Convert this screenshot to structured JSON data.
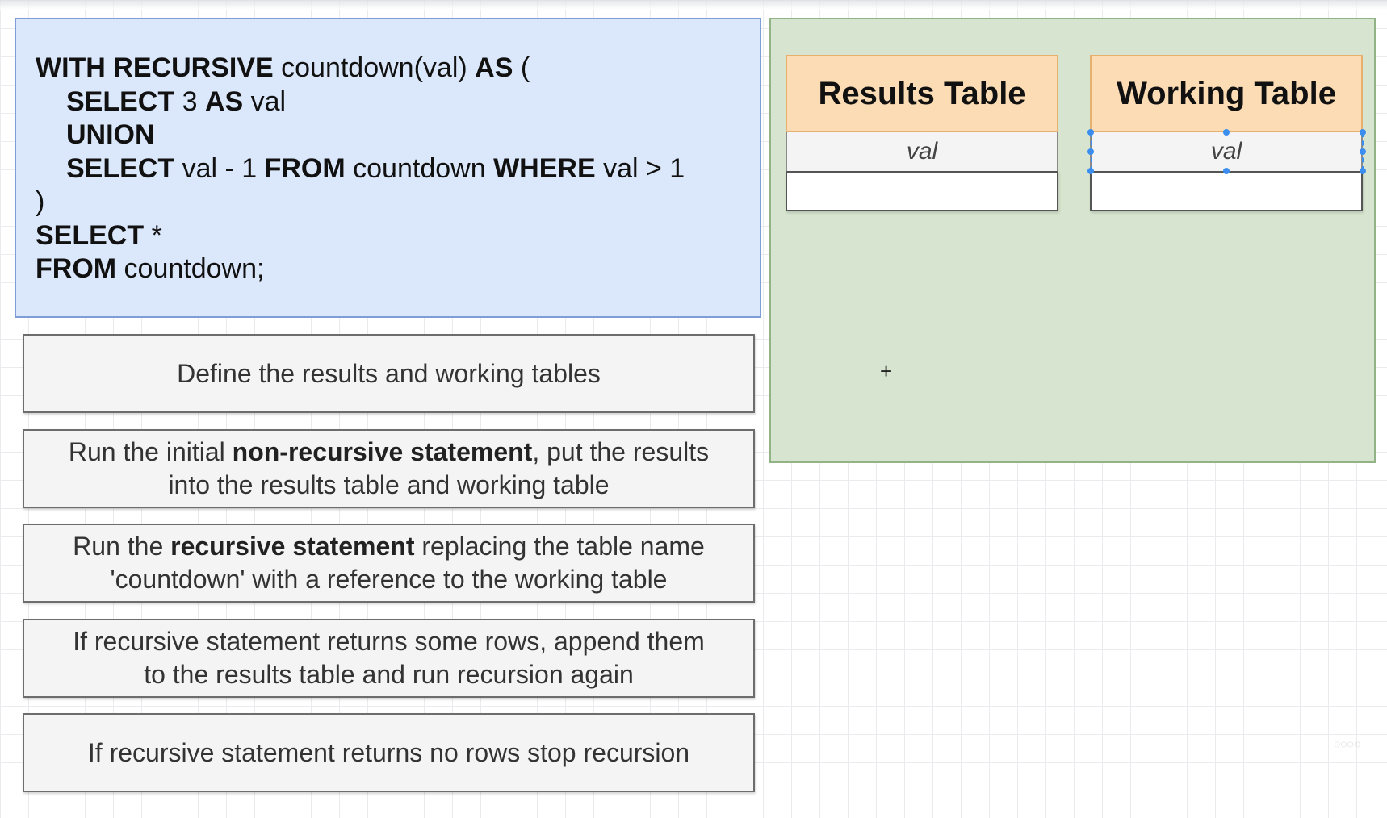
{
  "code": {
    "lines": [
      {
        "indent": false,
        "parts": [
          {
            "t": "WITH RECURSIVE",
            "b": true
          },
          {
            "t": " countdown(val) ",
            "b": false
          },
          {
            "t": "AS",
            "b": true
          },
          {
            "t": " (",
            "b": false
          }
        ]
      },
      {
        "indent": true,
        "parts": [
          {
            "t": "SELECT",
            "b": true
          },
          {
            "t": " 3 ",
            "b": false
          },
          {
            "t": "AS",
            "b": true
          },
          {
            "t": " val",
            "b": false
          }
        ]
      },
      {
        "indent": true,
        "parts": [
          {
            "t": "UNION",
            "b": true
          }
        ]
      },
      {
        "indent": true,
        "parts": [
          {
            "t": "SELECT",
            "b": true
          },
          {
            "t": " val - 1 ",
            "b": false
          },
          {
            "t": "FROM",
            "b": true
          },
          {
            "t": " countdown ",
            "b": false
          },
          {
            "t": "WHERE",
            "b": true
          },
          {
            "t": " val > 1",
            "b": false
          }
        ]
      },
      {
        "indent": false,
        "parts": [
          {
            "t": ")",
            "b": false
          }
        ]
      },
      {
        "indent": false,
        "parts": [
          {
            "t": "SELECT",
            "b": true
          },
          {
            "t": " *",
            "b": false
          }
        ]
      },
      {
        "indent": false,
        "parts": [
          {
            "t": "FROM",
            "b": true
          },
          {
            "t": " countdown;",
            "b": false
          }
        ]
      }
    ]
  },
  "steps": [
    {
      "lines": [
        [
          {
            "t": "Define the results and working tables",
            "b": false
          }
        ]
      ]
    },
    {
      "lines": [
        [
          {
            "t": "Run the initial ",
            "b": false
          },
          {
            "t": "non-recursive statement",
            "b": true
          },
          {
            "t": ", put the results",
            "b": false
          }
        ],
        [
          {
            "t": "into the results table and working table",
            "b": false
          }
        ]
      ]
    },
    {
      "lines": [
        [
          {
            "t": "Run the ",
            "b": false
          },
          {
            "t": "recursive statement",
            "b": true
          },
          {
            "t": " replacing the table name",
            "b": false
          }
        ],
        [
          {
            "t": "'countdown' with a reference to the working table",
            "b": false
          }
        ]
      ]
    },
    {
      "lines": [
        [
          {
            "t": "If recursive statement returns some rows, append them",
            "b": false
          }
        ],
        [
          {
            "t": "to the results table and run recursion again",
            "b": false
          }
        ]
      ]
    },
    {
      "lines": [
        [
          {
            "t": "If recursive statement returns no rows stop recursion",
            "b": false
          }
        ]
      ]
    }
  ],
  "tables": {
    "results": {
      "title": "Results Table",
      "column": "val"
    },
    "working": {
      "title": "Working Table",
      "column": "val"
    }
  },
  "colors": {
    "code_bg": "#dbe7fa",
    "green_area": "#d7e5d0",
    "table_header": "#fbdcb4",
    "selection": "#3b8ef0"
  }
}
